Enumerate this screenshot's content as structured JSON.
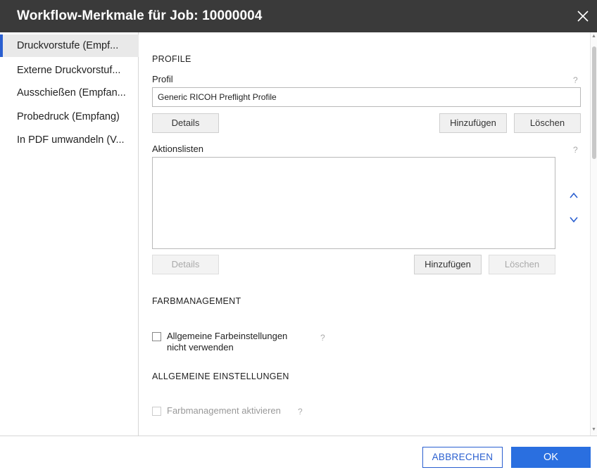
{
  "dialog": {
    "title": "Workflow-Merkmale für Job: 10000004",
    "close_icon": "close-icon"
  },
  "sidebar": {
    "items": [
      {
        "label": "Druckvorstufe (Empf...",
        "active": true
      },
      {
        "label": "Externe Druckvorstuf...",
        "active": false
      },
      {
        "label": "Ausschießen (Empfan...",
        "active": false
      },
      {
        "label": "Probedruck (Empfang)",
        "active": false
      },
      {
        "label": "In PDF umwandeln (V...",
        "active": false
      }
    ]
  },
  "profile": {
    "section_title": "PROFILE",
    "field_label": "Profil",
    "help": "?",
    "value": "Generic RICOH Preflight Profile",
    "details_label": "Details",
    "add_label": "Hinzufügen",
    "delete_label": "Löschen"
  },
  "action_lists": {
    "label": "Aktionslisten",
    "help": "?",
    "details_label": "Details",
    "add_label": "Hinzufügen",
    "delete_label": "Löschen",
    "up_icon": "chevron-up-icon",
    "down_icon": "chevron-down-icon"
  },
  "color_management": {
    "section_title": "FARBMANAGEMENT",
    "checkbox_label_line1": "Allgemeine Farbeinstellungen",
    "checkbox_label_line2": "nicht verwenden",
    "help": "?",
    "checked": false
  },
  "general_settings": {
    "section_title": "ALLGEMEINE EINSTELLUNGEN",
    "checkbox_label": "Farbmanagement aktivieren",
    "help": "?",
    "checked": false,
    "disabled": true
  },
  "footer": {
    "cancel_label": "ABBRECHEN",
    "ok_label": "OK"
  },
  "colors": {
    "titlebar": "#3a3a3a",
    "accent": "#2a5fd0",
    "ok_button": "#2a6fe0"
  }
}
